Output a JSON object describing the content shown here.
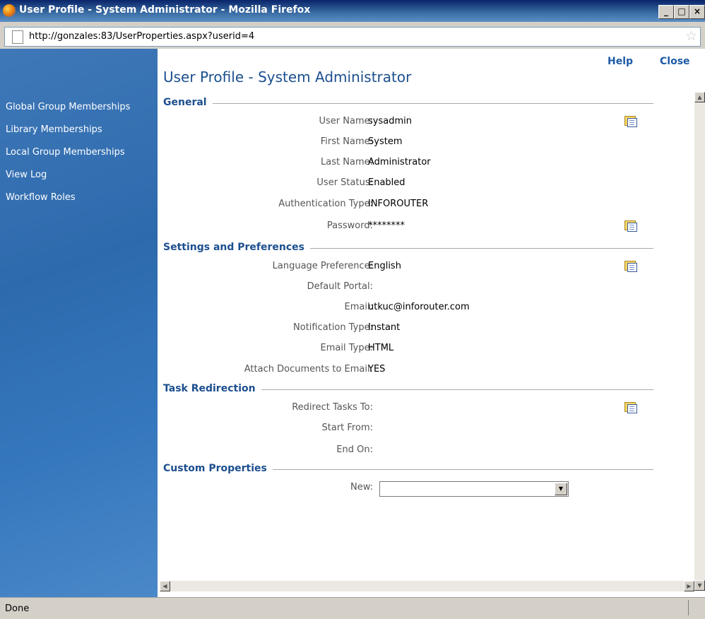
{
  "window": {
    "title": "User Profile - System Administrator - Mozilla Firefox",
    "buttons": {
      "minimize": "_",
      "maximize": "□",
      "close": "×"
    }
  },
  "address_bar": {
    "url": "http://gonzales:83/UserProperties.aspx?userid=4",
    "star": "☆"
  },
  "sidebar": {
    "items": [
      {
        "label": "Global Group Memberships"
      },
      {
        "label": "Library Memberships"
      },
      {
        "label": "Local Group Memberships"
      },
      {
        "label": "View Log"
      },
      {
        "label": "Workflow Roles"
      }
    ]
  },
  "header": {
    "help": "Help",
    "close": "Close",
    "page_title": "User Profile - System Administrator"
  },
  "sections": {
    "general": {
      "title": "General",
      "fields": [
        {
          "label": "User Name:",
          "value": "sysadmin"
        },
        {
          "label": "First Name:",
          "value": "System"
        },
        {
          "label": "Last Name:",
          "value": "Administrator"
        },
        {
          "label": "User Status:",
          "value": "Enabled"
        },
        {
          "label": "Authentication Type:",
          "value": "INFOROUTER"
        },
        {
          "label": "Password:",
          "value": "********"
        }
      ]
    },
    "settings": {
      "title": "Settings and Preferences",
      "fields": [
        {
          "label": "Language Preference:",
          "value": "English"
        },
        {
          "label": "Default Portal:",
          "value": ""
        },
        {
          "label": "Email:",
          "value": "utkuc@inforouter.com"
        },
        {
          "label": "Notification Type:",
          "value": "Instant"
        },
        {
          "label": "Email Type:",
          "value": "HTML"
        },
        {
          "label": "Attach Documents to Email:",
          "value": "YES"
        }
      ]
    },
    "task_redirection": {
      "title": "Task Redirection",
      "fields": [
        {
          "label": "Redirect Tasks To:",
          "value": ""
        },
        {
          "label": "Start From:",
          "value": ""
        },
        {
          "label": "End On:",
          "value": ""
        }
      ]
    },
    "custom": {
      "title": "Custom Properties",
      "new_label": "New:",
      "new_value": ""
    }
  },
  "statusbar": {
    "text": "Done"
  },
  "colors": {
    "accent": "#1c4f8f",
    "sidebar": "#2d6aad",
    "link": "#1c5aa6"
  },
  "icons": [
    "firefox-icon",
    "page-icon",
    "bookmark-star-icon",
    "edit-properties-icon",
    "dropdown-arrow-icon"
  ]
}
